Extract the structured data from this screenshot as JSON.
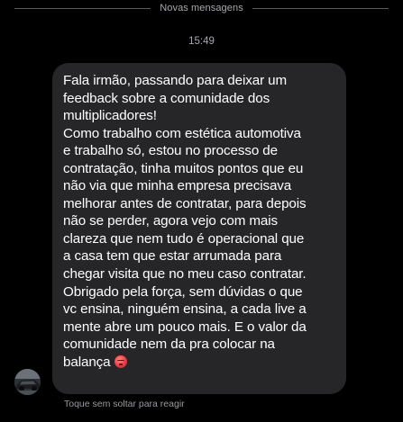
{
  "divider": {
    "label": "Novas mensagens"
  },
  "timestamp": "15:49",
  "message": {
    "text": "Fala irmão, passando para deixar um\nfeedback sobre a comunidade dos\nmultiplicadores!\nComo trabalho com estética automotiva\ne trabalho só, estou no processo de\ncontratação, tinha muitos pontos que eu\nnão via que minha empresa precisava\nmelhorar antes de contratar, para depois\nnão se perder, agora vejo com mais\nclareza que nem tudo é operacional que\na casa tem que estar arrumada para\nchegar visita que no meu caso contratar.\nObrigado pela força, sem dúvidas o que\nvc ensina, ninguém ensina, a cada live a\nmente abre um pouco mais. E o valor da\ncomunidade nem da pra colocar na\nbalança",
    "emoji": "hot-face-emoji"
  },
  "reaction_hint": "Toque sem soltar para reagir",
  "colors": {
    "background": "#000000",
    "bubble": "#262629",
    "divider_line": "#5a5a5e",
    "muted_text": "#a8a8ad"
  }
}
